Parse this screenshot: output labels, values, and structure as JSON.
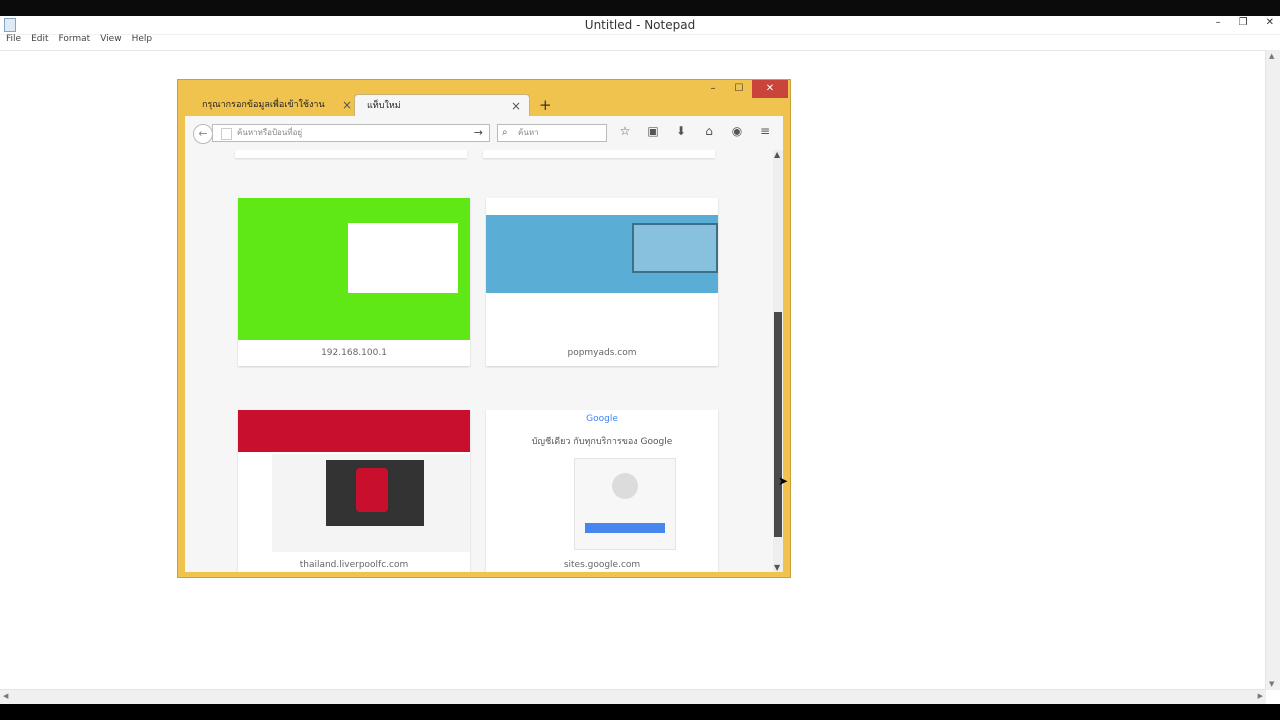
{
  "notepad": {
    "title": "Untitled - Notepad",
    "menu": [
      "File",
      "Edit",
      "Format",
      "View",
      "Help"
    ]
  },
  "browser": {
    "tabs": [
      {
        "label": "กรุณากรอกข้อมูลเพื่อเข้าใช้งาน"
      },
      {
        "label": "แท็บใหม่"
      }
    ],
    "url_placeholder": "ค้นหาหรือป้อนที่อยู่",
    "search_placeholder": "ค้นหา",
    "tiles": [
      {
        "caption": "192.168.100.1"
      },
      {
        "caption": "popmyads.com"
      },
      {
        "caption": "thailand.liverpoolfc.com"
      },
      {
        "caption": "sites.google.com",
        "logo": "Google",
        "heading": "บัญชีเดียว กับทุกบริการของ Google"
      }
    ]
  },
  "colors": {
    "firefox_frame": "#f0c24e",
    "close_button": "#c9443a",
    "green_thumb": "#5fe815",
    "lfc_red": "#c8102e",
    "ads_blue": "#5aaed6"
  }
}
